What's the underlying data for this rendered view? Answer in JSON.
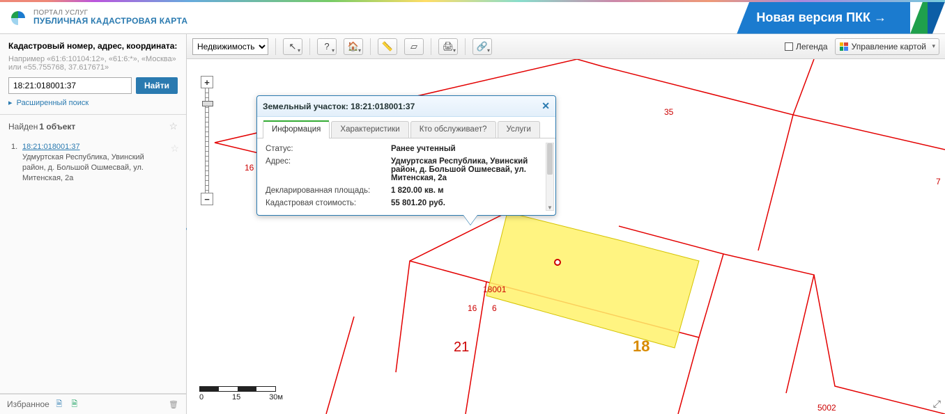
{
  "header": {
    "portal_line": "ПОРТАЛ УСЛУГ",
    "title_line": "ПУБЛИЧНАЯ КАДАСТРОВАЯ КАРТА",
    "new_version": "Новая версия ПКК →"
  },
  "search": {
    "label": "Кадастровый номер, адрес, координата:",
    "hint": "Например «61:6:10104:12», «61:6:*», «Москва» или «55.755768, 37.617671»",
    "value": "18:21:018001:37",
    "button": "Найти",
    "advanced": "Расширенный поиск"
  },
  "results": {
    "found_label_prefix": "Найден ",
    "found_label_count": "1 объект",
    "items": [
      {
        "num": "1.",
        "cn": "18:21:018001:37",
        "addr": "Удмуртская Республика, Увинский район, д. Большой Ошмесвай, ул. Митенская, 2а"
      }
    ]
  },
  "favorites": {
    "label": "Избранное"
  },
  "toolbar": {
    "object_type": "Недвижимость",
    "legend": "Легенда",
    "manage_map": "Управление картой"
  },
  "popup": {
    "title": "Земельный участок: 18:21:018001:37",
    "tabs": [
      "Информация",
      "Характеристики",
      "Кто обслуживает?",
      "Услуги"
    ],
    "active_tab": 0,
    "rows": [
      {
        "k": "Статус:",
        "v": "Ранее учтенный"
      },
      {
        "k": "Адрес:",
        "v": "Удмуртская Республика, Увинский район, д. Большой Ошмесвай, ул. Митенская, 2а"
      },
      {
        "k": "Декларированная площадь:",
        "v": "1 820.00 кв. м"
      },
      {
        "k": "Кадастровая стоимость:",
        "v": "55 801.20 руб."
      }
    ]
  },
  "map_labels": {
    "block": "18001",
    "l16a": "16",
    "l16b": "16",
    "l6": "6",
    "l21": "21",
    "l18": "18",
    "l35": "35",
    "l7": "7",
    "l5002": "5002"
  },
  "scale": {
    "t0": "0",
    "t1": "15",
    "t2": "30м"
  }
}
